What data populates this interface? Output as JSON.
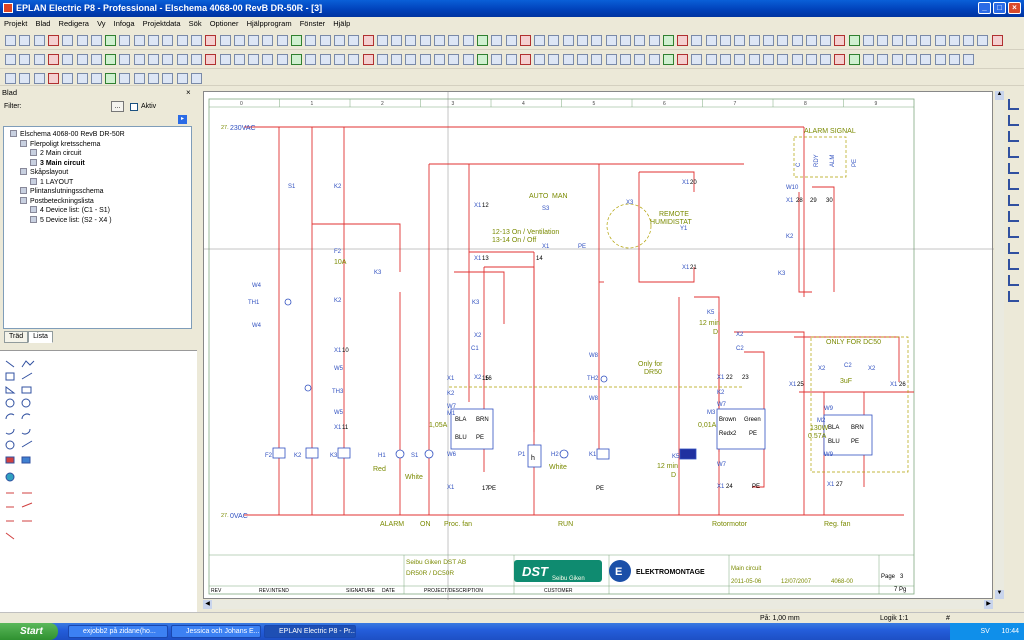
{
  "window": {
    "title": "EPLAN Electric P8 - Professional - Elschema 4068-00 RevB DR-50R - [3]"
  },
  "menu": [
    "Projekt",
    "Blad",
    "Redigera",
    "Vy",
    "Infoga",
    "Projektdata",
    "Sök",
    "Optioner",
    "Hjälpprogram",
    "Fönster",
    "Hjälp"
  ],
  "panel": {
    "title": "Blad",
    "filter_label": "Filter:",
    "filter_button": "...",
    "active_label": "Aktiv",
    "tree": [
      {
        "text": "Elschema 4068-00 RevB DR-50R",
        "level": 0,
        "bold": false
      },
      {
        "text": "Flerpoligt kretsschema",
        "level": 1,
        "bold": false
      },
      {
        "text": "2 Main circuit",
        "level": 2,
        "bold": false
      },
      {
        "text": "3 Main circuit",
        "level": 2,
        "bold": true
      },
      {
        "text": "Skåpslayout",
        "level": 1,
        "bold": false
      },
      {
        "text": "1 LAYOUT",
        "level": 2,
        "bold": false
      },
      {
        "text": "Plintanslutningsschema",
        "level": 1,
        "bold": false
      },
      {
        "text": "Postbeteckningslista",
        "level": 1,
        "bold": false
      },
      {
        "text": "4 Device list: (C1 - S1)",
        "level": 2,
        "bold": false
      },
      {
        "text": "5 Device list: (S2 - X4 )",
        "level": 2,
        "bold": false
      }
    ],
    "tabs": [
      "Träd",
      "Lista"
    ]
  },
  "schematic": {
    "columns": [
      "0",
      "1",
      "2",
      "3",
      "4",
      "5",
      "6",
      "7",
      "8",
      "9"
    ],
    "top_rail": "230VAC",
    "top_rail_ref": "27.",
    "bottom_rail": "0VAC",
    "bottom_rail_ref": "27.",
    "labels": {
      "alarm_signal": "ALARM SIGNAL",
      "only_dc50": "ONLY FOR DC50",
      "auto": "AUTO",
      "man": "MAN",
      "remote": "REMOTE",
      "humidistat": "HUMIDISTAT",
      "note1": "12-13 On / Ventilation",
      "note2": "13-14 On / Off",
      "only_for": "Only for",
      "dr50": "DR50",
      "alarm": "ALARM",
      "on": "ON",
      "proc_fan": "Proc. fan",
      "run": "RUN",
      "rotormotor": "Rotormotor",
      "reg_fan": "Reg. fan",
      "red": "Red",
      "white": "White",
      "white2": "White",
      "k5_time": "12 min",
      "k5_d": "D",
      "k5b_time": "12 min",
      "k5b_d": "D",
      "fuse": "10A",
      "m1_current": "1,05A",
      "m3_current": "0,01A",
      "m2_power": "130W",
      "m2_current": "0.57A",
      "c2": "3uF",
      "c1": "C1",
      "m1": "M1",
      "m3": "M3",
      "m2": "M2"
    },
    "title_block": {
      "company": "Seibu Giken DST AB",
      "project": "DR50R / DC50R",
      "brand": "ELEKTROMONTAGE",
      "sheet_title": "Main circuit",
      "date1": "2011-05-06",
      "date2": "12/07/2007",
      "drawing_no": "4068-00",
      "page_label": "Page",
      "page_no": "3",
      "pages": "7 Pg",
      "rev": "REV",
      "revintend": "REV.INTEND",
      "signature": "SIGNATURE",
      "date": "DATE",
      "proj_desc": "PROJECT/DESCRIPTION",
      "customer": "CUSTOMER",
      "dst_logo": "DST",
      "seibu_logo": "Seibu Giken"
    }
  },
  "status": {
    "position": "På: 1,00 mm",
    "logic": "Logik 1:1",
    "hash": "#"
  },
  "taskbar": {
    "start": "Start",
    "tasks": [
      "exjobb2 på zidane(ho...",
      "Jessica och Johans E...",
      "EPLAN Electric P8 - Pr..."
    ],
    "lang": "SV",
    "clock": "10:44"
  },
  "colors": {
    "wire": "#e03030",
    "text_green": "#7a8a00",
    "text_blue": "#2020c0",
    "border": "#88b088"
  }
}
